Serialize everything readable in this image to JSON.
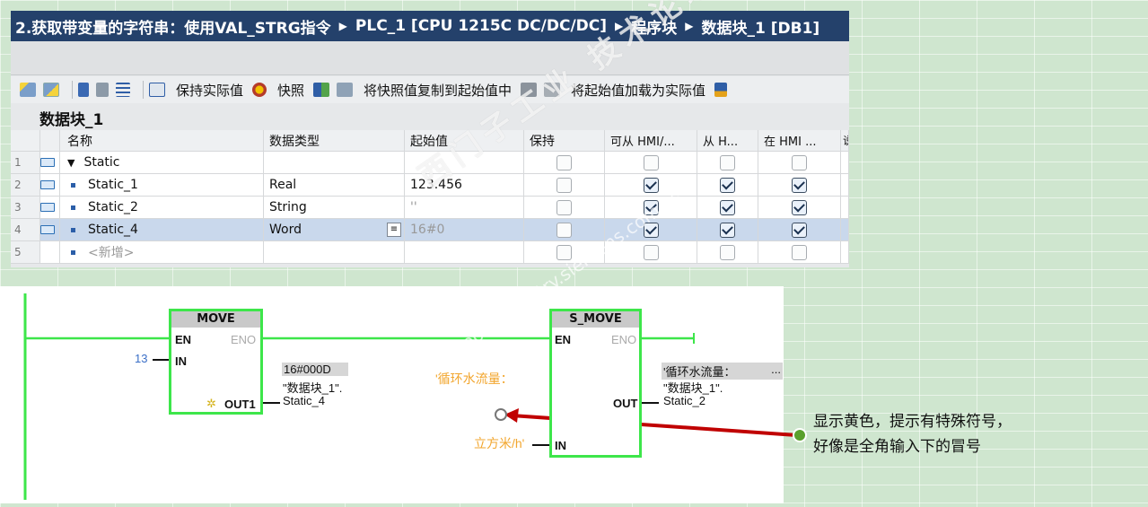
{
  "editor": {
    "title_parts": [
      "2.获取带变量的字符串：使用VAL_STRG指令",
      "PLC_1 [CPU 1215C DC/DC/DC]",
      "程序块",
      "数据块_1 [DB1]"
    ],
    "toolbar": {
      "keep_actual": "保持实际值",
      "snapshot": "快照",
      "copy_snapshot": "将快照值复制到起始值中",
      "load_start": "将起始值加载为实际值"
    },
    "db_name": "数据块_1",
    "columns": [
      "名称",
      "数据类型",
      "起始值",
      "保持",
      "可从 HMI/...",
      "从 H...",
      "在 HMI ...",
      "说"
    ],
    "rows": [
      {
        "idx": "1",
        "name": "Static",
        "type": "",
        "start": "",
        "keep": false,
        "hmi1": false,
        "hmi2": false,
        "hmi3": false
      },
      {
        "idx": "2",
        "name": "Static_1",
        "type": "Real",
        "start": "123.456",
        "keep": false,
        "hmi1": true,
        "hmi2": true,
        "hmi3": true
      },
      {
        "idx": "3",
        "name": "Static_2",
        "type": "String",
        "start": "''",
        "keep": false,
        "hmi1": true,
        "hmi2": true,
        "hmi3": true
      },
      {
        "idx": "4",
        "name": "Static_4",
        "type": "Word",
        "start": "16#0",
        "keep": false,
        "hmi1": true,
        "hmi2": true,
        "hmi3": true
      },
      {
        "idx": "5",
        "name": "<新增>",
        "type": "",
        "start": "",
        "keep": false,
        "hmi1": false,
        "hmi2": false,
        "hmi3": false
      }
    ]
  },
  "ladder": {
    "move": {
      "title": "MOVE",
      "en": "EN",
      "eno": "ENO",
      "in": "IN",
      "out": "OUT1",
      "in_value": "13",
      "out_value": "16#000D",
      "out_tag_1": "\"数据块_1\".",
      "out_tag_2": "Static_4"
    },
    "s_move": {
      "title": "S_MOVE",
      "en": "EN",
      "eno": "ENO",
      "in": "IN",
      "out": "OUT",
      "in_tag_1": "'循环水流量：",
      "in_tag_2": "立方米/h'",
      "out_value_1": "'循环水流量：",
      "out_value_2": "...",
      "out_tag_1": "\"数据块_1\".",
      "out_tag_2": "Static_2"
    }
  },
  "annotation": {
    "line1": "显示黄色，提示有特殊符号，",
    "line2": "好像是全角输入下的冒号"
  },
  "watermark": "西门子工业 技术论坛",
  "watermark_url": "support.industry.siemens.com/cs",
  "colors": {
    "title_bar": "#24416b",
    "rung_green": "#3de64a",
    "arrow_red": "#c00000",
    "marker_green": "#5aa02c",
    "orange_text": "#f2a62e"
  }
}
